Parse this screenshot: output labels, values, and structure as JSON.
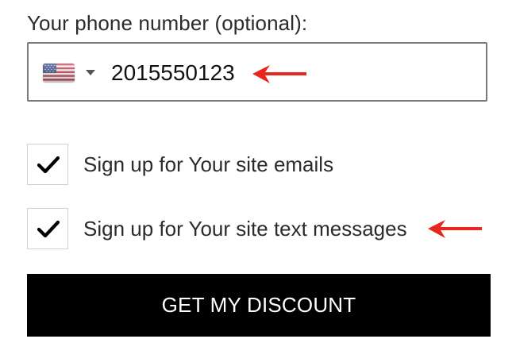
{
  "phone": {
    "label": "Your phone number (optional):",
    "country_flag_icon": "us-flag-icon",
    "dropdown_icon": "chevron-down-icon",
    "value": "2015550123"
  },
  "checkboxes": [
    {
      "label": "Sign up for Your site emails",
      "checked": true,
      "icon": "checkmark-icon"
    },
    {
      "label": "Sign up for Your site text messages",
      "checked": true,
      "icon": "checkmark-icon"
    }
  ],
  "submit": {
    "label": "GET MY DISCOUNT"
  },
  "annotations": {
    "arrow_icon": "red-arrow-icon",
    "arrow_color": "#e8261e"
  },
  "colors": {
    "button_background": "#000000",
    "button_text": "#ffffff",
    "field_border": "#7a7a7a"
  }
}
